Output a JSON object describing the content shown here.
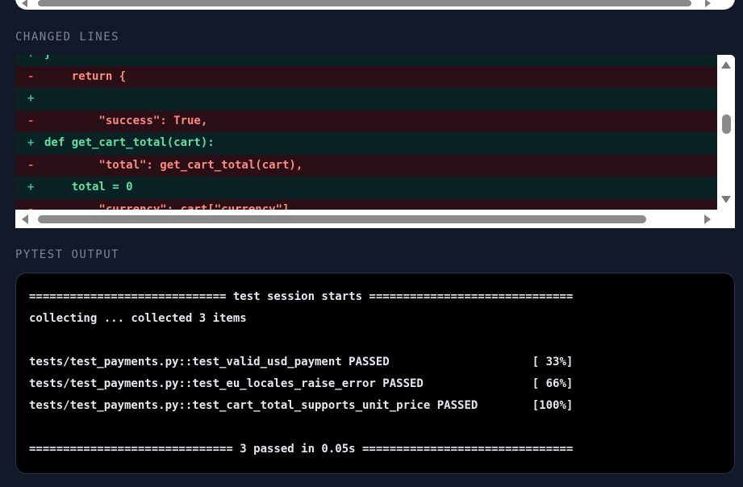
{
  "sections": {
    "changed_lines": "CHANGED LINES",
    "pytest_output": "PYTEST OUTPUT"
  },
  "diff": {
    "lines": [
      {
        "type": "add",
        "sign": "+",
        "code": "}"
      },
      {
        "type": "del",
        "sign": "-",
        "code": "    return {"
      },
      {
        "type": "add",
        "sign": "+",
        "code": ""
      },
      {
        "type": "del",
        "sign": "-",
        "code": "        \"success\": True,"
      },
      {
        "type": "add",
        "sign": "+",
        "code": "def get_cart_total(cart):"
      },
      {
        "type": "del",
        "sign": "-",
        "code": "        \"total\": get_cart_total(cart),"
      },
      {
        "type": "add",
        "sign": "+",
        "code": "    total = 0"
      },
      {
        "type": "del",
        "sign": "-",
        "code": "        \"currency\": cart[\"currency\"]"
      }
    ]
  },
  "pytest": {
    "lines": [
      "============================= test session starts ==============================",
      "collecting ... collected 3 items",
      "",
      "tests/test_payments.py::test_valid_usd_payment PASSED                     [ 33%]",
      "tests/test_payments.py::test_eu_locales_raise_error PASSED                [ 66%]",
      "tests/test_payments.py::test_cart_total_supports_unit_price PASSED        [100%]",
      "",
      "============================== 3 passed in 0.05s ==============================="
    ]
  },
  "colors": {
    "background": "#121a2a",
    "diff_added_bg": "#0a2223",
    "diff_added_text": "#5ee0a4",
    "diff_removed_bg": "#2a0f16",
    "diff_removed_text": "#ff8a80",
    "terminal_bg": "#000000"
  }
}
